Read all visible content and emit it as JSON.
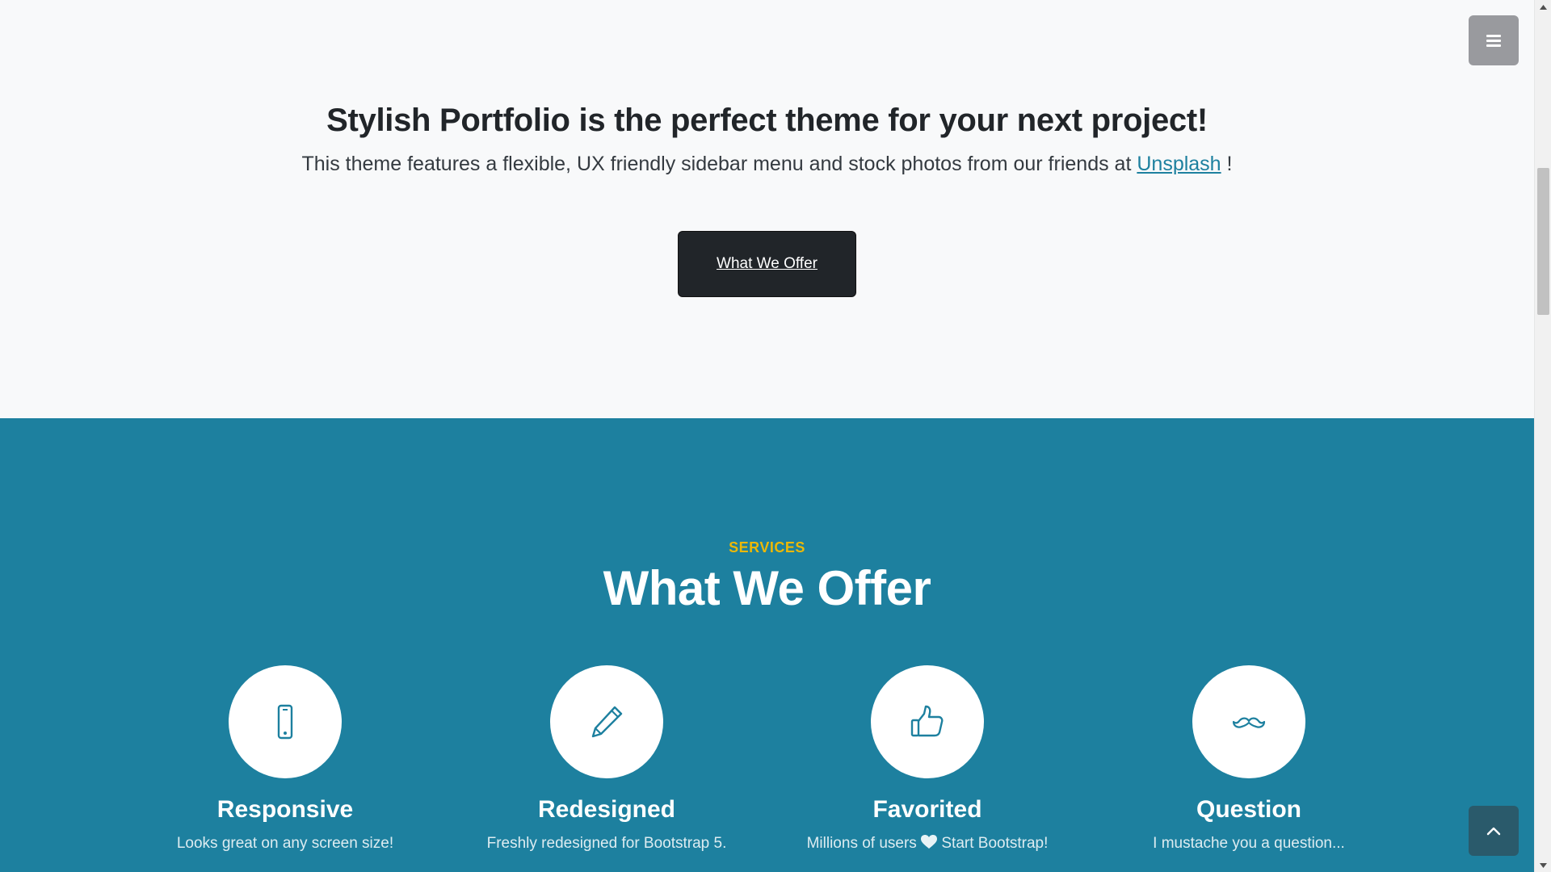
{
  "about": {
    "title": "Stylish Portfolio is the perfect theme for your next project!",
    "lead_text": "This theme features a flexible, UX friendly sidebar menu and stock photos from our friends at",
    "link_text": "Unsplash",
    "lead_suffix": "!",
    "button_label": "What We Offer"
  },
  "services": {
    "subheading": "SERVICES",
    "title": "What We Offer",
    "items": [
      {
        "icon": "phone-icon",
        "title": "Responsive",
        "text": "Looks great on any screen size!"
      },
      {
        "icon": "pencil-icon",
        "title": "Redesigned",
        "text": "Freshly redesigned for Bootstrap 5."
      },
      {
        "icon": "thumbs-up-icon",
        "title": "Favorited",
        "text_before": "Millions of users",
        "text_after": "Start Bootstrap!"
      },
      {
        "icon": "mustache-icon",
        "title": "Question",
        "text": "I mustache you a question..."
      }
    ]
  },
  "colors": {
    "primary": "#1d809f",
    "secondary": "#ecb807",
    "dark": "#212529",
    "light": "#f8f9fa"
  }
}
